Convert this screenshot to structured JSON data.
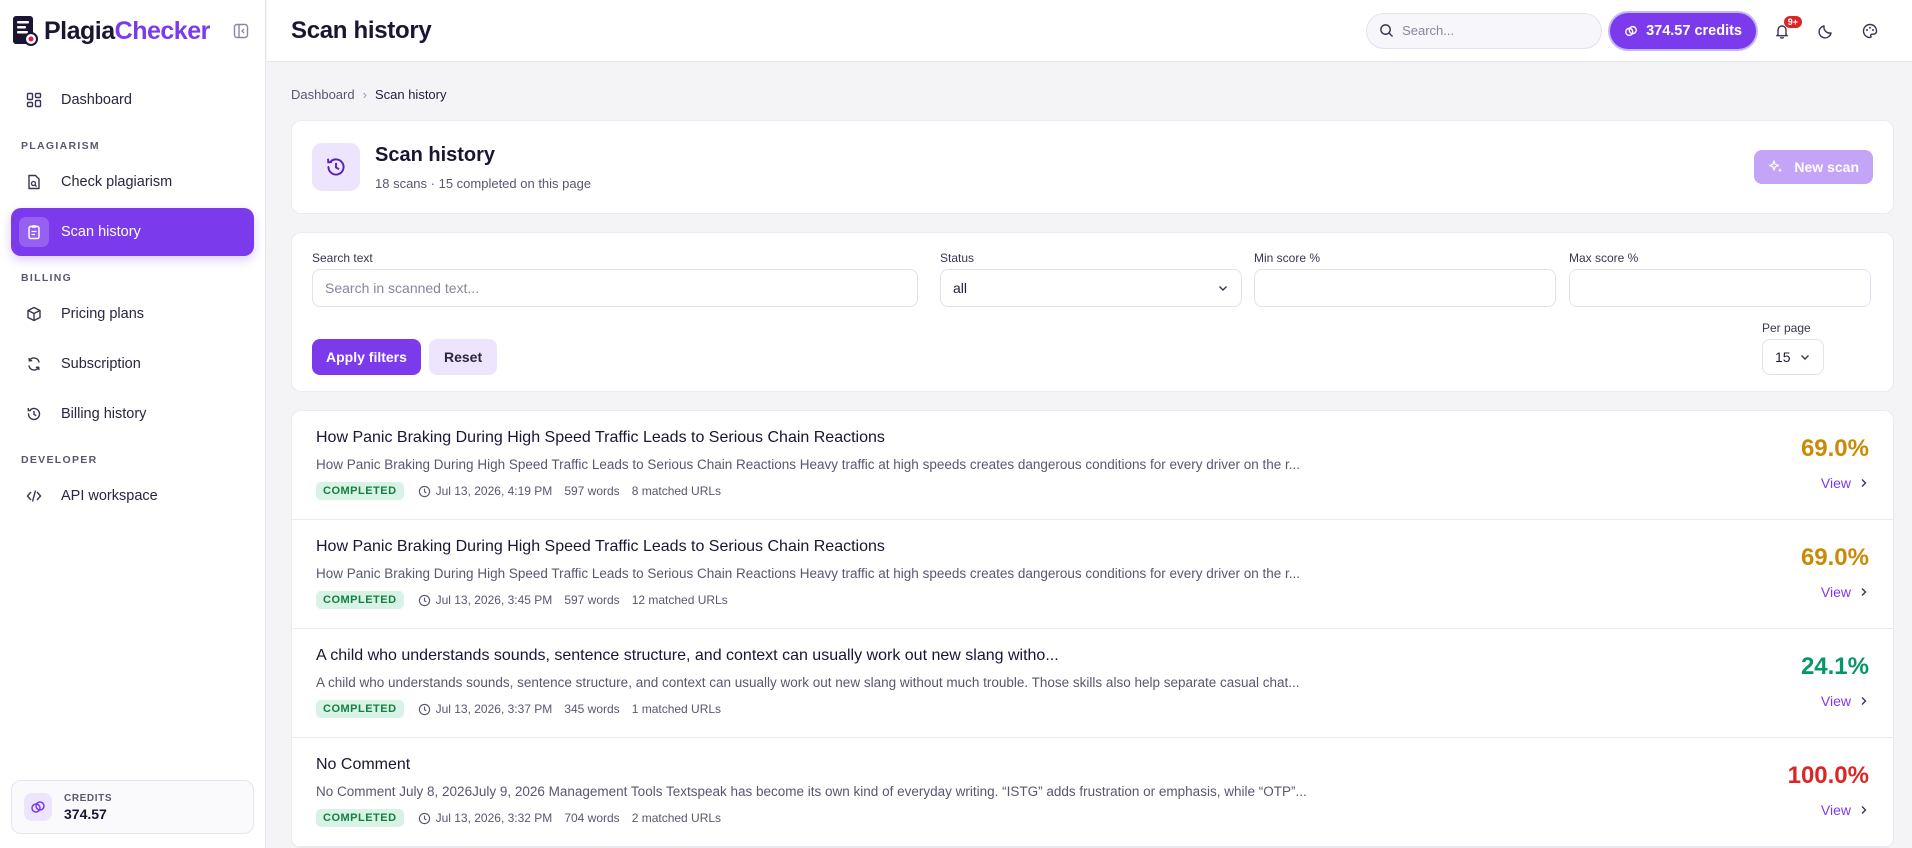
{
  "brand": {
    "name_part1": "Plagia",
    "name_part2": "Checker"
  },
  "sidebar": {
    "items": [
      {
        "label": "Dashboard"
      },
      {
        "label": "Check plagiarism"
      },
      {
        "label": "Scan history"
      },
      {
        "label": "Pricing plans"
      },
      {
        "label": "Subscription"
      },
      {
        "label": "Billing history"
      },
      {
        "label": "API workspace"
      }
    ],
    "sections": {
      "plagiarism": "PLAGIARISM",
      "billing": "BILLING",
      "developer": "DEVELOPER"
    },
    "credits_label": "CREDITS",
    "credits_value": "374.57"
  },
  "topbar": {
    "title": "Scan history",
    "search_placeholder": "Search...",
    "credits": "374.57 credits",
    "notification_badge": "9+"
  },
  "breadcrumb": {
    "home": "Dashboard",
    "current": "Scan history"
  },
  "header": {
    "title": "Scan history",
    "subtitle": "18 scans · 15 completed on this page",
    "new_scan": "New scan"
  },
  "filters": {
    "search_label": "Search text",
    "search_placeholder": "Search in scanned text...",
    "status_label": "Status",
    "status_value": "all",
    "min_label": "Min score %",
    "max_label": "Max score %",
    "apply": "Apply filters",
    "reset": "Reset",
    "per_page_label": "Per page",
    "per_page_value": "15"
  },
  "scans": [
    {
      "title": "How Panic Braking During High Speed Traffic Leads to Serious Chain Reactions",
      "snippet": "How Panic Braking During High Speed Traffic Leads to Serious Chain Reactions Heavy traffic at high speeds creates dangerous conditions for every driver on the r...",
      "status": "COMPLETED",
      "date": "Jul 13, 2026, 4:19 PM",
      "words": "597 words",
      "urls": "8 matched URLs",
      "score": "69.0%",
      "score_color": "#ca8a04",
      "view": "View"
    },
    {
      "title": "How Panic Braking During High Speed Traffic Leads to Serious Chain Reactions",
      "snippet": "How Panic Braking During High Speed Traffic Leads to Serious Chain Reactions Heavy traffic at high speeds creates dangerous conditions for every driver on the r...",
      "status": "COMPLETED",
      "date": "Jul 13, 2026, 3:45 PM",
      "words": "597 words",
      "urls": "12 matched URLs",
      "score": "69.0%",
      "score_color": "#ca8a04",
      "view": "View"
    },
    {
      "title": "A child who understands sounds, sentence structure, and context can usually work out new slang witho...",
      "snippet": "A child who understands sounds, sentence structure, and context can usually work out new slang without much trouble. Those skills also help separate casual chat...",
      "status": "COMPLETED",
      "date": "Jul 13, 2026, 3:37 PM",
      "words": "345 words",
      "urls": "1 matched URLs",
      "score": "24.1%",
      "score_color": "#059669",
      "view": "View"
    },
    {
      "title": "No Comment",
      "snippet": "No Comment July 8, 2026July 9, 2026 Management Tools Textspeak has become its own kind of everyday writing. “ISTG” adds frustration or emphasis, while “OTP”...",
      "status": "COMPLETED",
      "date": "Jul 13, 2026, 3:32 PM",
      "words": "704 words",
      "urls": "2 matched URLs",
      "score": "100.0%",
      "score_color": "#dc2626",
      "view": "View"
    }
  ],
  "colors": {
    "accent": "#7c3aed",
    "accent_light": "#ede5fd"
  }
}
